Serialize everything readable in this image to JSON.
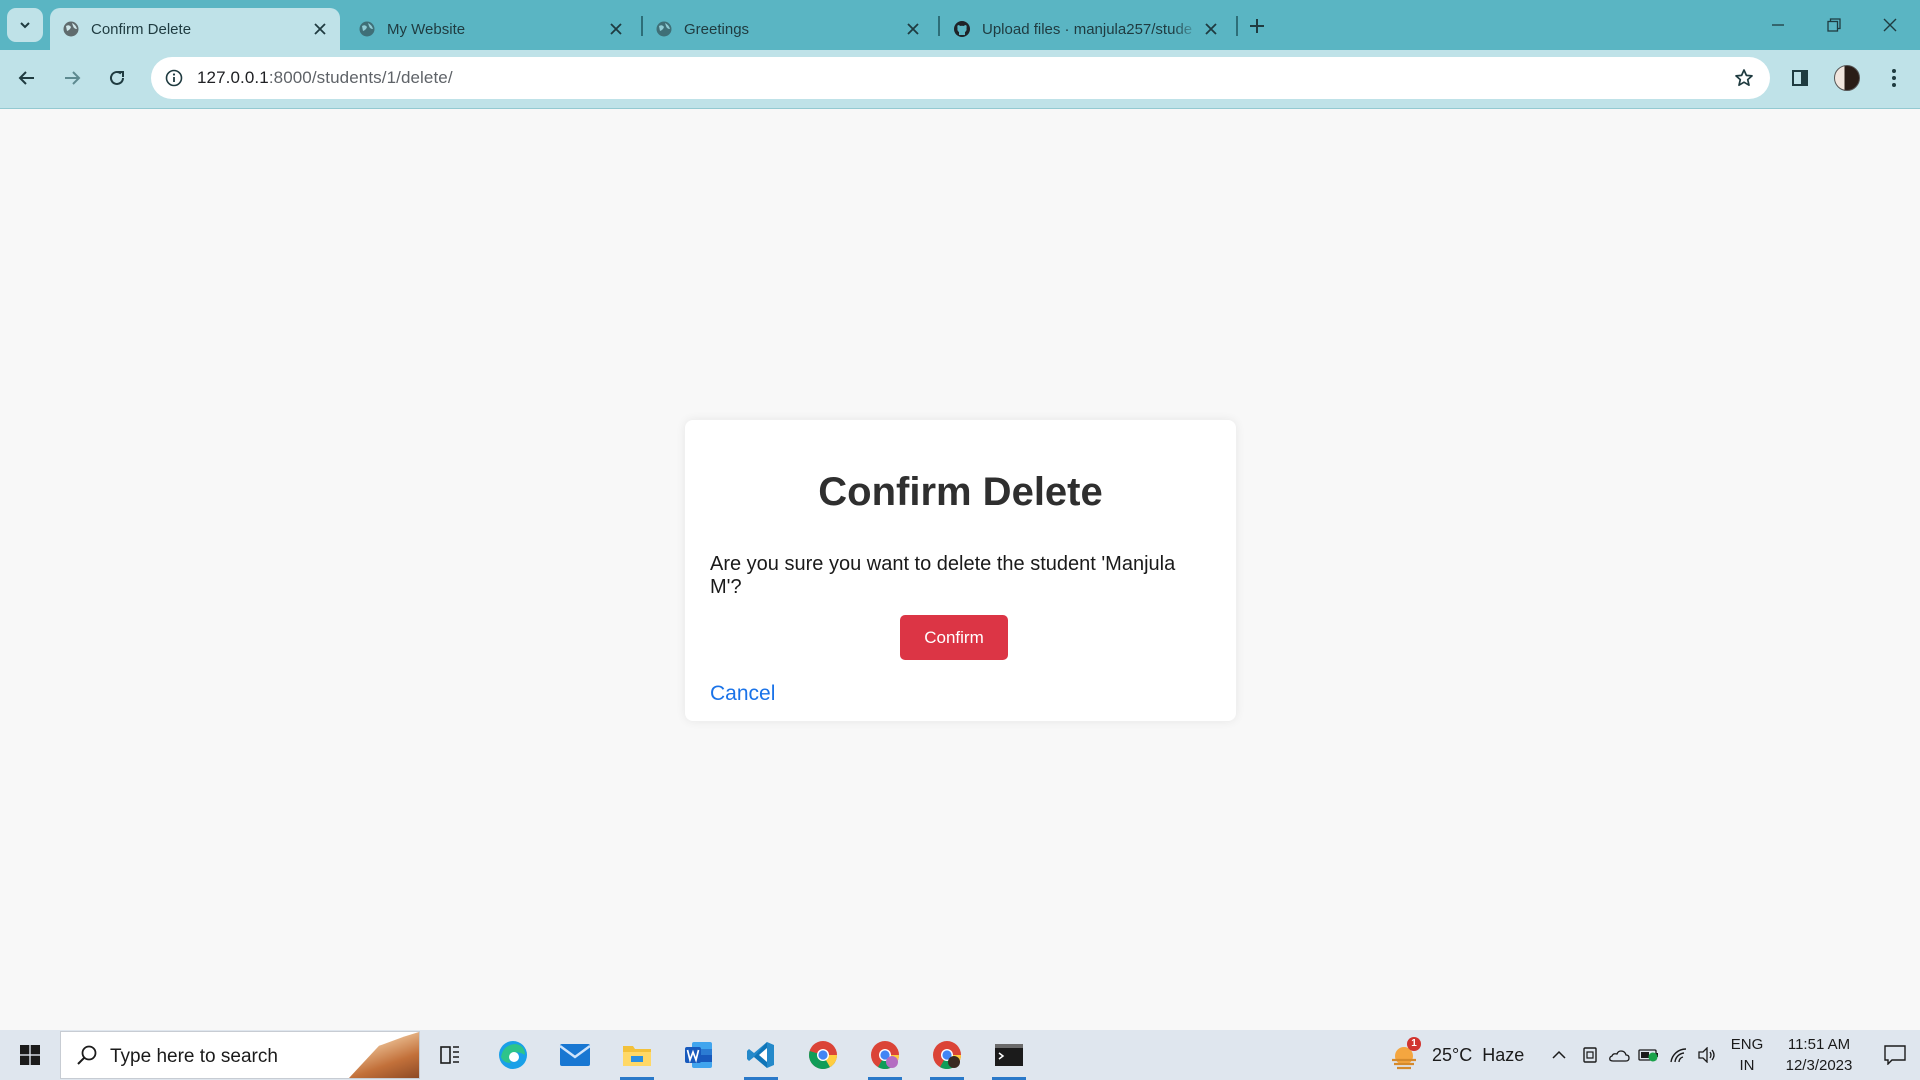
{
  "browser": {
    "tabs": [
      {
        "title": "Confirm Delete",
        "active": true,
        "favicon": "globe-icon"
      },
      {
        "title": "My Website",
        "active": false,
        "favicon": "globe-icon"
      },
      {
        "title": "Greetings",
        "active": false,
        "favicon": "globe-icon"
      },
      {
        "title": "Upload files · manjula257/stude",
        "active": false,
        "favicon": "github-icon"
      }
    ],
    "url_host": "127.0.0.1",
    "url_path": ":8000/students/1/delete/"
  },
  "page": {
    "heading": "Confirm Delete",
    "message": "Are you sure you want to delete the student 'Manjula M'?",
    "confirm_label": "Confirm",
    "cancel_label": "Cancel",
    "confirm_color": "#dc3545",
    "link_color": "#1a73e8"
  },
  "taskbar": {
    "search_placeholder": "Type here to search",
    "weather_temp": "25°C",
    "weather_cond": "Haze",
    "weather_badge": "1",
    "lang_top": "ENG",
    "lang_bottom": "IN",
    "time": "11:51 AM",
    "date": "12/3/2023",
    "pinned_apps": [
      "task-view-icon",
      "edge-icon",
      "mail-icon",
      "file-explorer-icon",
      "word-icon",
      "vscode-icon",
      "chrome-icon",
      "chrome-profile-icon",
      "chrome-profile-2-icon",
      "terminal-icon"
    ]
  },
  "colors": {
    "chrome_frame": "#5ab5c3",
    "chrome_toolbar": "#bfe2e8",
    "page_bg": "#f8f8f8"
  }
}
